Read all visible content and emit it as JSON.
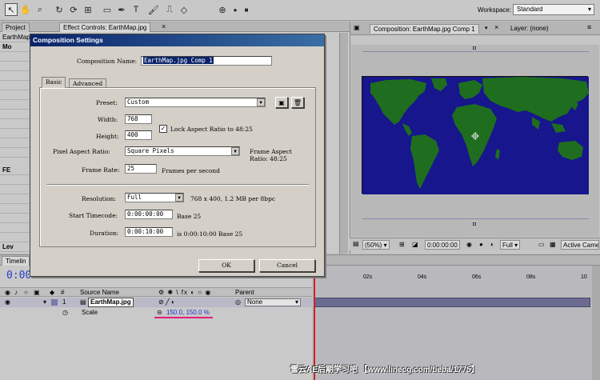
{
  "toolbar": {
    "workspace_label": "Workspace:",
    "workspace_value": "Standard",
    "tools": [
      "selection-tool-icon",
      "hand-tool-icon",
      "zoom-tool-icon",
      "rotate-tool-icon",
      "orbit-camera-icon",
      "pan-behind-icon",
      "rectangle-mask-icon",
      "pen-tool-icon",
      "type-tool-icon",
      "brush-tool-icon",
      "clone-stamp-icon",
      "eraser-tool-icon"
    ]
  },
  "left_panel": {
    "tabs": [
      "Project",
      "Effect Controls: EarthMap.jpg"
    ],
    "layer_label": "EarthMap",
    "rows": [
      "Mo",
      "FE",
      "Lev"
    ]
  },
  "comp_panel": {
    "tab_label": "Composition: EarthMap.jpg Comp 1",
    "layer_tab": "Layer: (none)",
    "zoom": "(50%)",
    "timecode": "0:00:00:00",
    "resolution": "Full",
    "camera": "Active Came",
    "colors": {
      "ocean": "#17168c",
      "land": "#1f6e1f"
    }
  },
  "dialog": {
    "title": "Composition Settings",
    "comp_name_label": "Composition Name:",
    "comp_name": "EarthMap.jpg Comp 1",
    "tab_basic": "Basic",
    "tab_advanced": "Advanced",
    "preset_label": "Preset:",
    "preset_value": "Custom",
    "width_label": "Width:",
    "width_value": "768",
    "height_label": "Height:",
    "height_value": "400",
    "lock_aspect": "Lock Aspect Ratio to 48:25",
    "lock_checked": "✓",
    "par_label": "Pixel Aspect Ratio:",
    "par_value": "Square Pixels",
    "frame_aspect_label": "Frame Aspect",
    "frame_aspect_value": "Ratio: 48:25",
    "frame_rate_label": "Frame Rate:",
    "frame_rate_value": "25",
    "frame_rate_unit": "Frames per second",
    "resolution_label": "Resolution:",
    "resolution_value": "Full",
    "resolution_info": "768 x 400, 1.2 MB per 8bpc",
    "start_tc_label": "Start Timecode:",
    "start_tc_value": "0:00:00:00",
    "start_tc_base": "Base 25",
    "duration_label": "Duration:",
    "duration_value": "0:00:10:00",
    "duration_info": "is 0:00:10:00  Base 25",
    "ok_label": "OK",
    "cancel_label": "Cancel"
  },
  "timeline": {
    "tab_label": "Timelin",
    "current_time": "0:00",
    "ruler": [
      "02s",
      "04s",
      "06s",
      "08s",
      "10"
    ],
    "col_num": "#",
    "col_source": "Source Name",
    "col_parent": "Parent",
    "layer_num": "1",
    "layer_name": "EarthMap.jpg",
    "parent_value": "None",
    "scale_label": "Scale",
    "scale_value": "150.0, 150.0 %"
  },
  "watermark": "雷云AE后期学习吧 【www.linecg.com/tieba/1775】"
}
